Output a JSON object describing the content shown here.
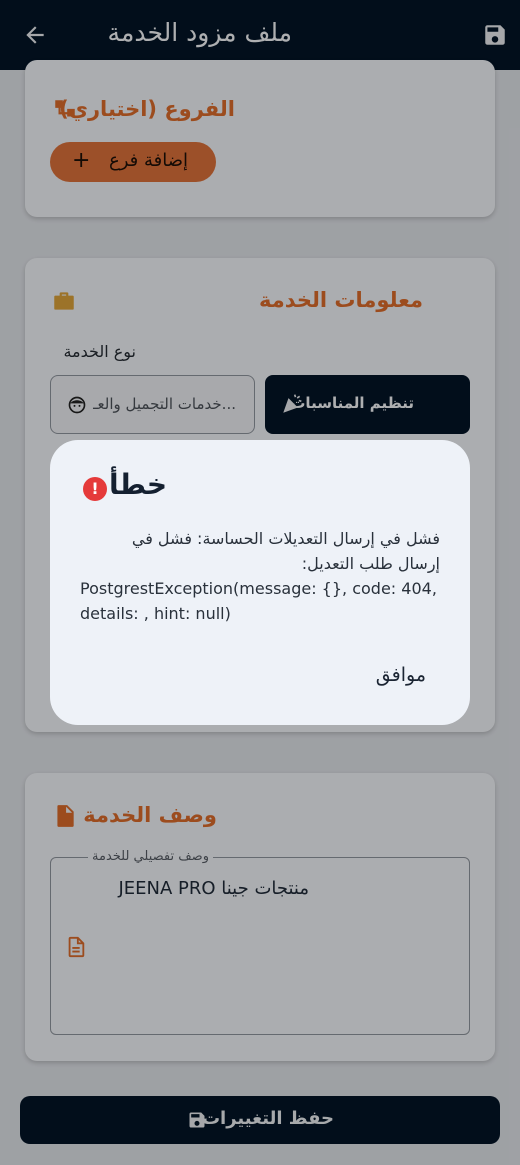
{
  "app_bar": {
    "title": "ملف مزود الخدمة"
  },
  "branches": {
    "title": "الفروع (اختياري)",
    "add_label": "إضافة فرع",
    "add_icon": "+"
  },
  "service_info": {
    "title": "معلومات الخدمة",
    "type_label": "نوع الخدمة",
    "type_selected": "تنظيم المناسبات",
    "type_other": "...خدمات التجميل والعـ"
  },
  "description": {
    "title": "وصف الخدمة",
    "field_label": "وصف تفصيلي للخدمة",
    "value": "JEENA PRO منتجات جينا"
  },
  "bottom": {
    "save_label": "حفظ التغييرات"
  },
  "dialog": {
    "title": "خطأ",
    "message_line1": "فشل في إرسال التعديلات الحساسة: فشل في",
    "message_line2": "إرسال طلب التعديل:",
    "message_line3": "PostgrestException(message: {}, code: 404,",
    "message_line4": "details: , hint: null)",
    "ok_label": "موافق"
  },
  "colors": {
    "primary": "#031426",
    "accent": "#d86a2a",
    "error": "#e53a3a",
    "page_bg": "#dcdfe4"
  }
}
